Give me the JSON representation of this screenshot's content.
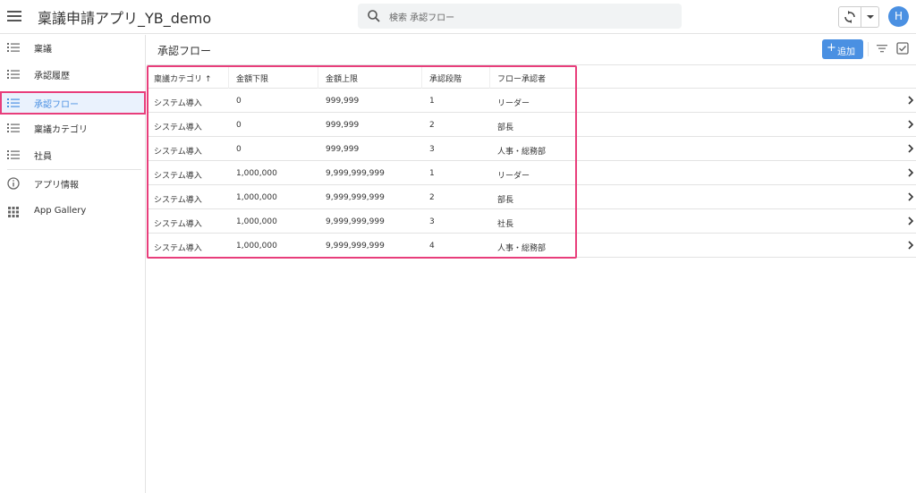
{
  "app": {
    "title": "稟議申請アプリ_YB_demo",
    "user_initial": "H",
    "accent_color": "#4a90e2",
    "highlight_color": "#e83e7b"
  },
  "search": {
    "placeholder": "検索 承認フロー"
  },
  "sidebar": {
    "items": [
      {
        "label": "稟議",
        "icon": "list-icon"
      },
      {
        "label": "承認履歴",
        "icon": "list-icon"
      },
      {
        "label": "承認フロー",
        "icon": "list-icon",
        "active": true
      },
      {
        "label": "稟議カテゴリ",
        "icon": "list-icon"
      },
      {
        "label": "社員",
        "icon": "list-icon"
      },
      {
        "label": "アプリ情報",
        "icon": "info-icon"
      },
      {
        "label": "App Gallery",
        "icon": "grid-icon"
      }
    ]
  },
  "main": {
    "title": "承認フロー",
    "add_label": "追加"
  },
  "table": {
    "columns": [
      "稟議カテゴリ",
      "金額下限",
      "金額上限",
      "承認段階",
      "フロー承認者"
    ],
    "sort_indicator": "↑",
    "rows": [
      [
        "システム導入",
        "0",
        "999,999",
        "1",
        "リーダー"
      ],
      [
        "システム導入",
        "0",
        "999,999",
        "2",
        "部長"
      ],
      [
        "システム導入",
        "0",
        "999,999",
        "3",
        "人事・総務部"
      ],
      [
        "システム導入",
        "1,000,000",
        "9,999,999,999",
        "1",
        "リーダー"
      ],
      [
        "システム導入",
        "1,000,000",
        "9,999,999,999",
        "2",
        "部長"
      ],
      [
        "システム導入",
        "1,000,000",
        "9,999,999,999",
        "3",
        "社長"
      ],
      [
        "システム導入",
        "1,000,000",
        "9,999,999,999",
        "4",
        "人事・総務部"
      ]
    ]
  }
}
